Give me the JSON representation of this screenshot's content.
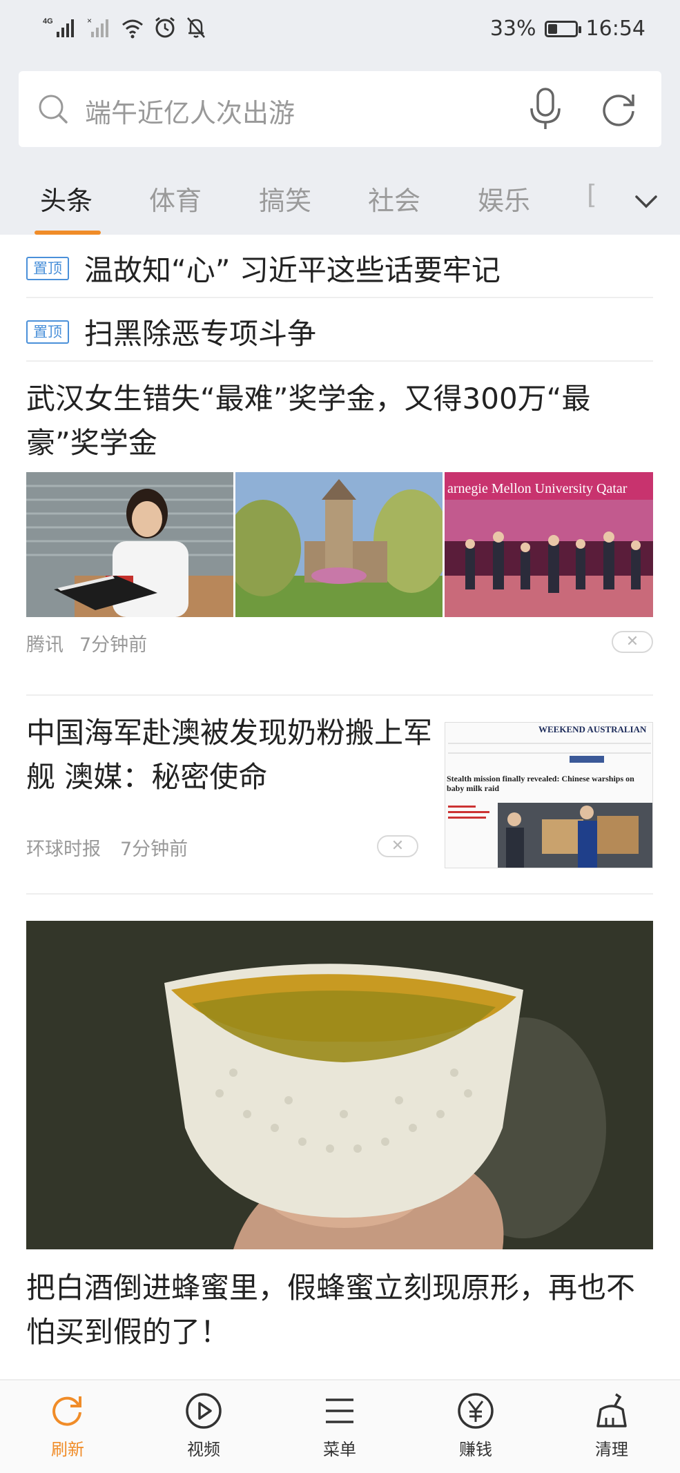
{
  "status_bar": {
    "network": "4G",
    "battery_percent": "33%",
    "battery_level": 0.33,
    "time": "16:54",
    "icons": [
      "signal-4g-icon",
      "signal-x-icon",
      "wifi-icon",
      "alarm-icon",
      "mute-bell-icon"
    ]
  },
  "search": {
    "placeholder": "端午近亿人次出游",
    "icons": [
      "search-icon",
      "mic-icon",
      "refresh-icon"
    ]
  },
  "tabs": [
    {
      "label": "头条",
      "active": true
    },
    {
      "label": "体育"
    },
    {
      "label": "搞笑"
    },
    {
      "label": "社会"
    },
    {
      "label": "娱乐"
    },
    {
      "label": "[",
      "partial": true
    }
  ],
  "accent_color": "#f08c28",
  "pin_color": "#4a90d9",
  "feed": {
    "pinned": [
      {
        "badge": "置顶",
        "title": "温故知“心” 习近平这些话要牢记"
      },
      {
        "badge": "置顶",
        "title": "扫黑除恶专项斗争"
      }
    ],
    "article1": {
      "title": "武汉女生错失“最难”奖学金，又得300万“最豪”奖学金",
      "source": "腾讯",
      "time": "7分钟前",
      "dismiss": "✕",
      "image_text_3": "arnegie Mellon University Qatar"
    },
    "article2": {
      "title": "中国海军赴澳被发现奶粉搬上军舰 澳媒：秘密使命",
      "source": "环球时报",
      "time": "7分钟前",
      "dismiss": "✕",
      "thumb_masthead": "WEEKEND AUSTRALIAN",
      "thumb_headline": "Stealth mission finally revealed: Chinese warships on baby milk raid"
    },
    "article3": {
      "title": "把白酒倒进蜂蜜里，假蜂蜜立刻现原形，再也不怕买到假的了！"
    }
  },
  "bottom_nav": [
    {
      "label": "刷新",
      "icon": "refresh-icon",
      "active": true
    },
    {
      "label": "视频",
      "icon": "play-icon"
    },
    {
      "label": "菜单",
      "icon": "menu-icon"
    },
    {
      "label": "赚钱",
      "icon": "yuan-icon"
    },
    {
      "label": "清理",
      "icon": "broom-icon"
    }
  ]
}
